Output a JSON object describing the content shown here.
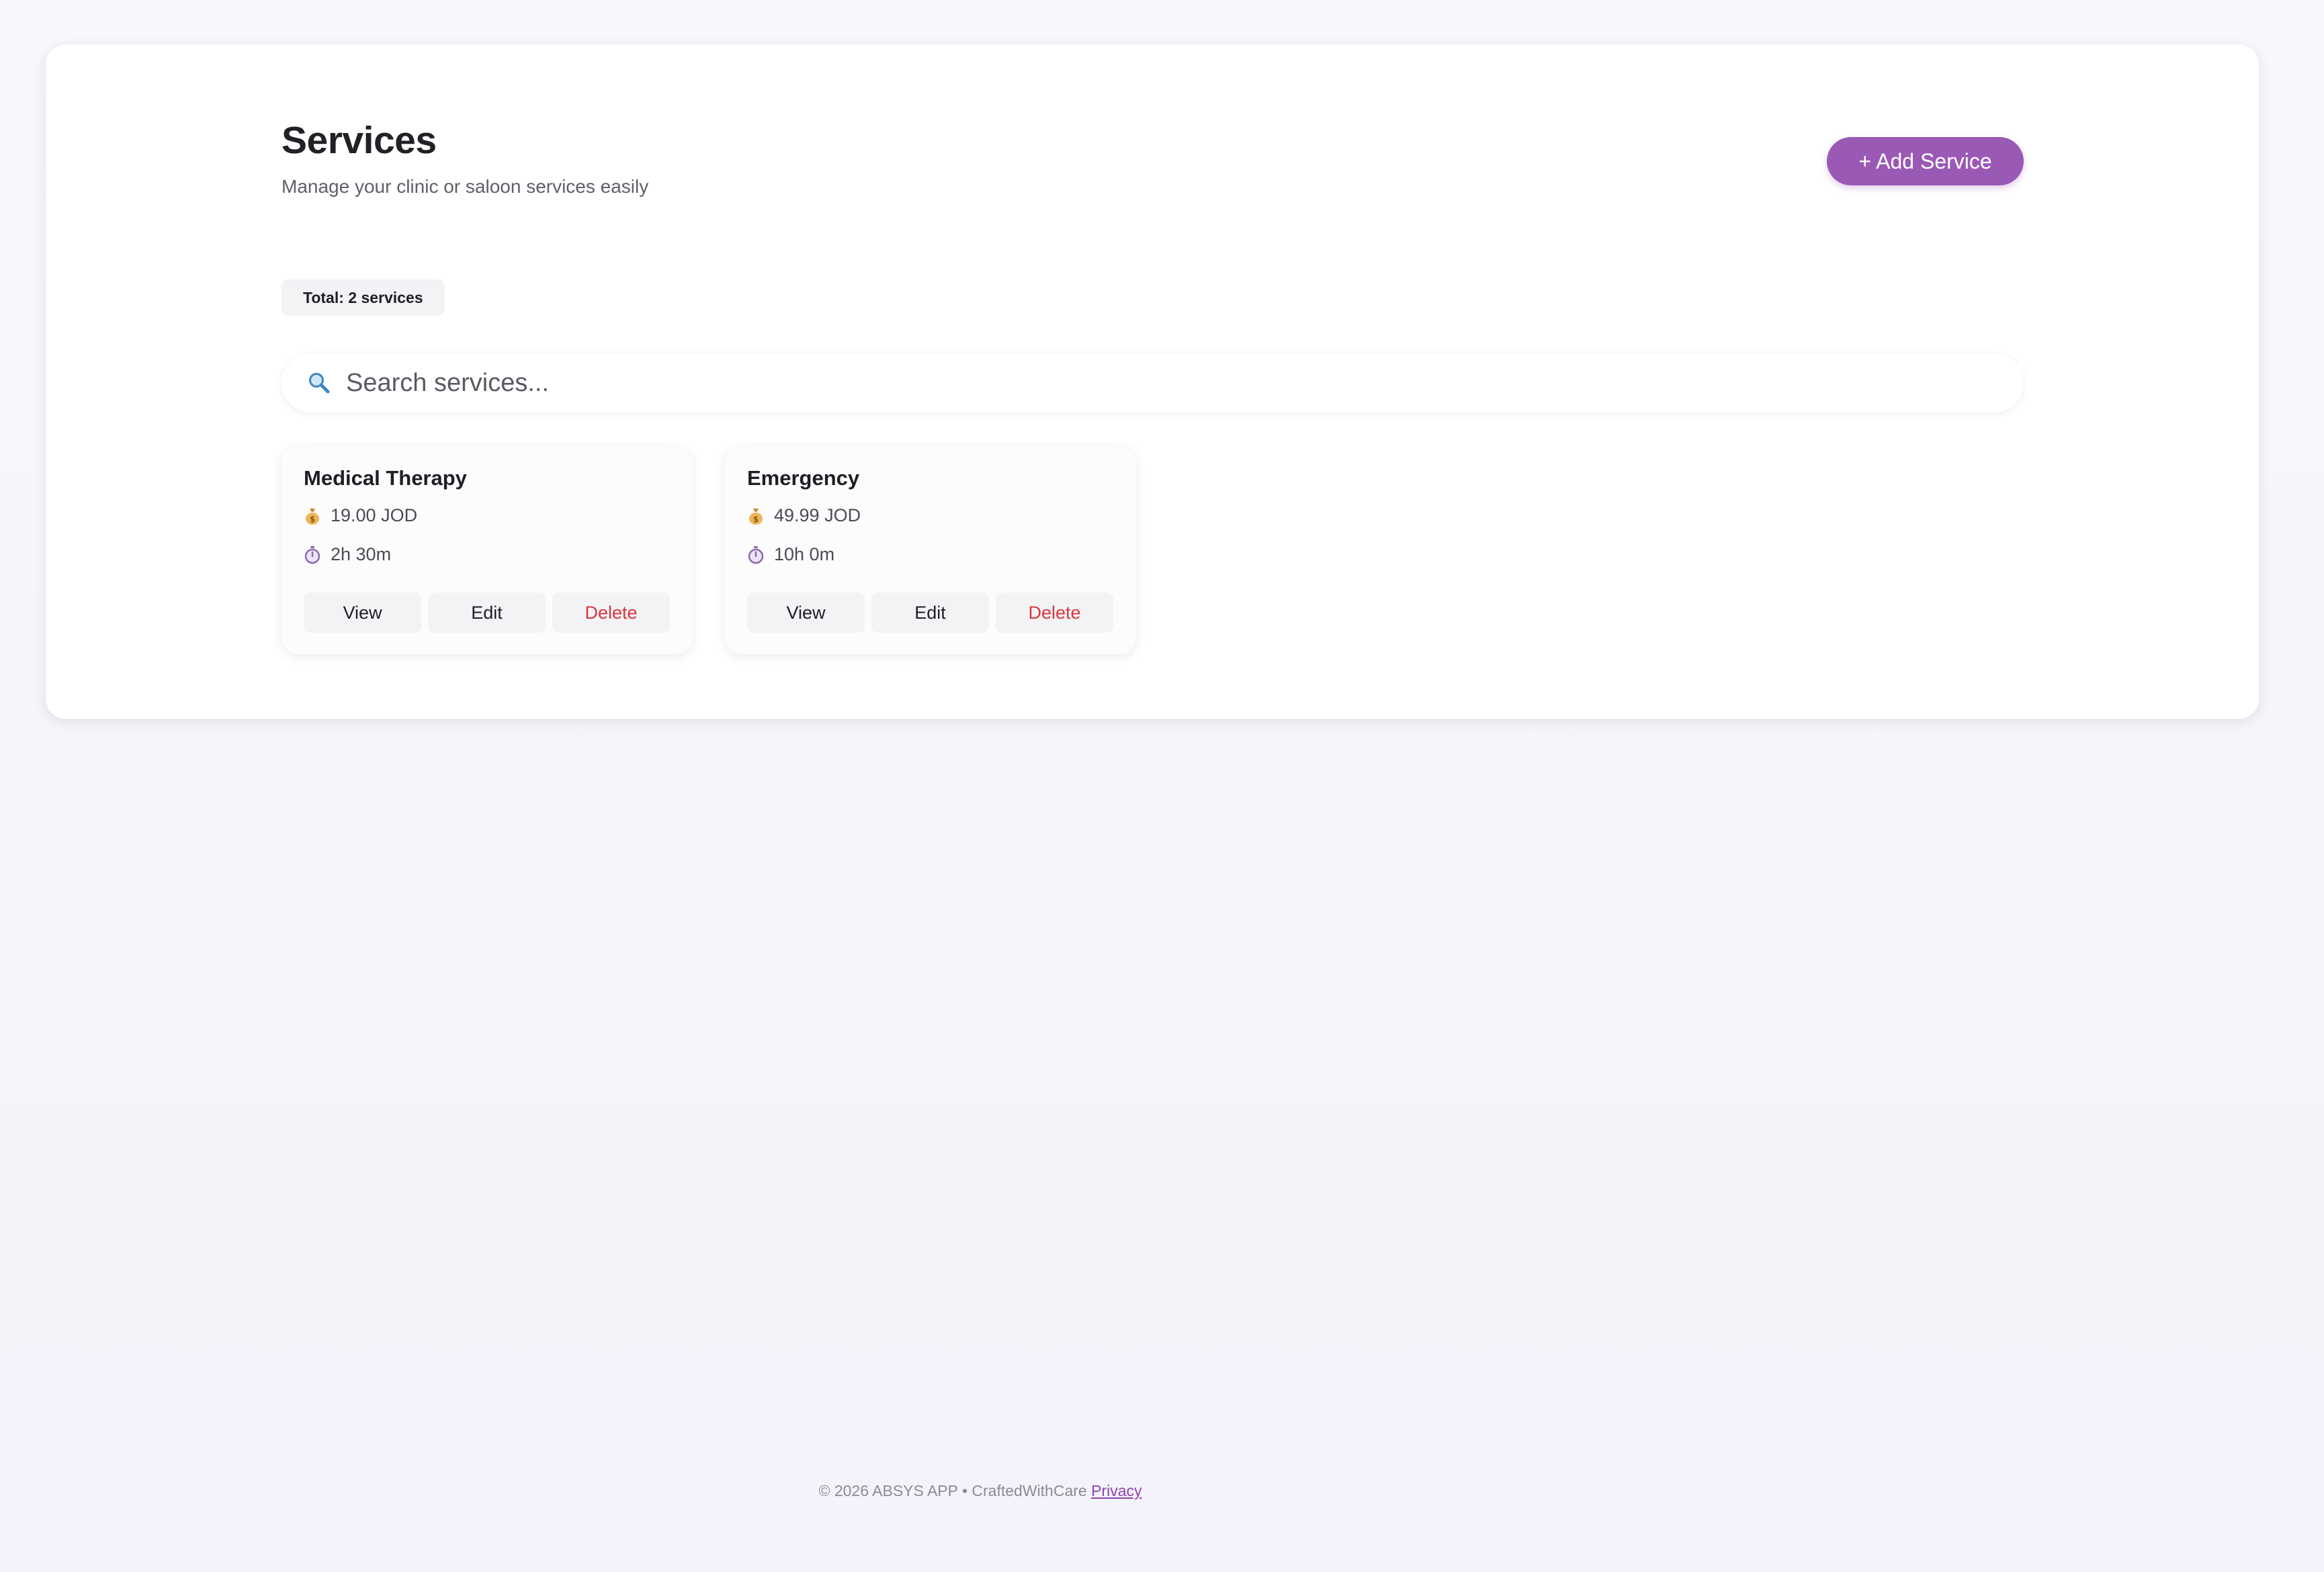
{
  "header": {
    "title": "Services",
    "subtitle": "Manage your clinic or saloon services easily",
    "add_button_label": "+ Add Service"
  },
  "summary": {
    "total_label": "Total: 2 services"
  },
  "search": {
    "placeholder": "Search services...",
    "value": "",
    "icon": "search-icon"
  },
  "services": [
    {
      "name": "Medical Therapy",
      "price": "19.00 JOD",
      "duration": "2h 30m",
      "actions": {
        "view": "View",
        "edit": "Edit",
        "delete": "Delete"
      }
    },
    {
      "name": "Emergency",
      "price": "49.99 JOD",
      "duration": "10h 0m",
      "actions": {
        "view": "View",
        "edit": "Edit",
        "delete": "Delete"
      }
    }
  ],
  "footer": {
    "text": "© 2026 ABSYS APP • CraftedWithCare",
    "privacy_link": "Privacy"
  },
  "colors": {
    "accent": "#9b59b6",
    "danger": "#d9363e",
    "background": "#f6f5fa"
  }
}
